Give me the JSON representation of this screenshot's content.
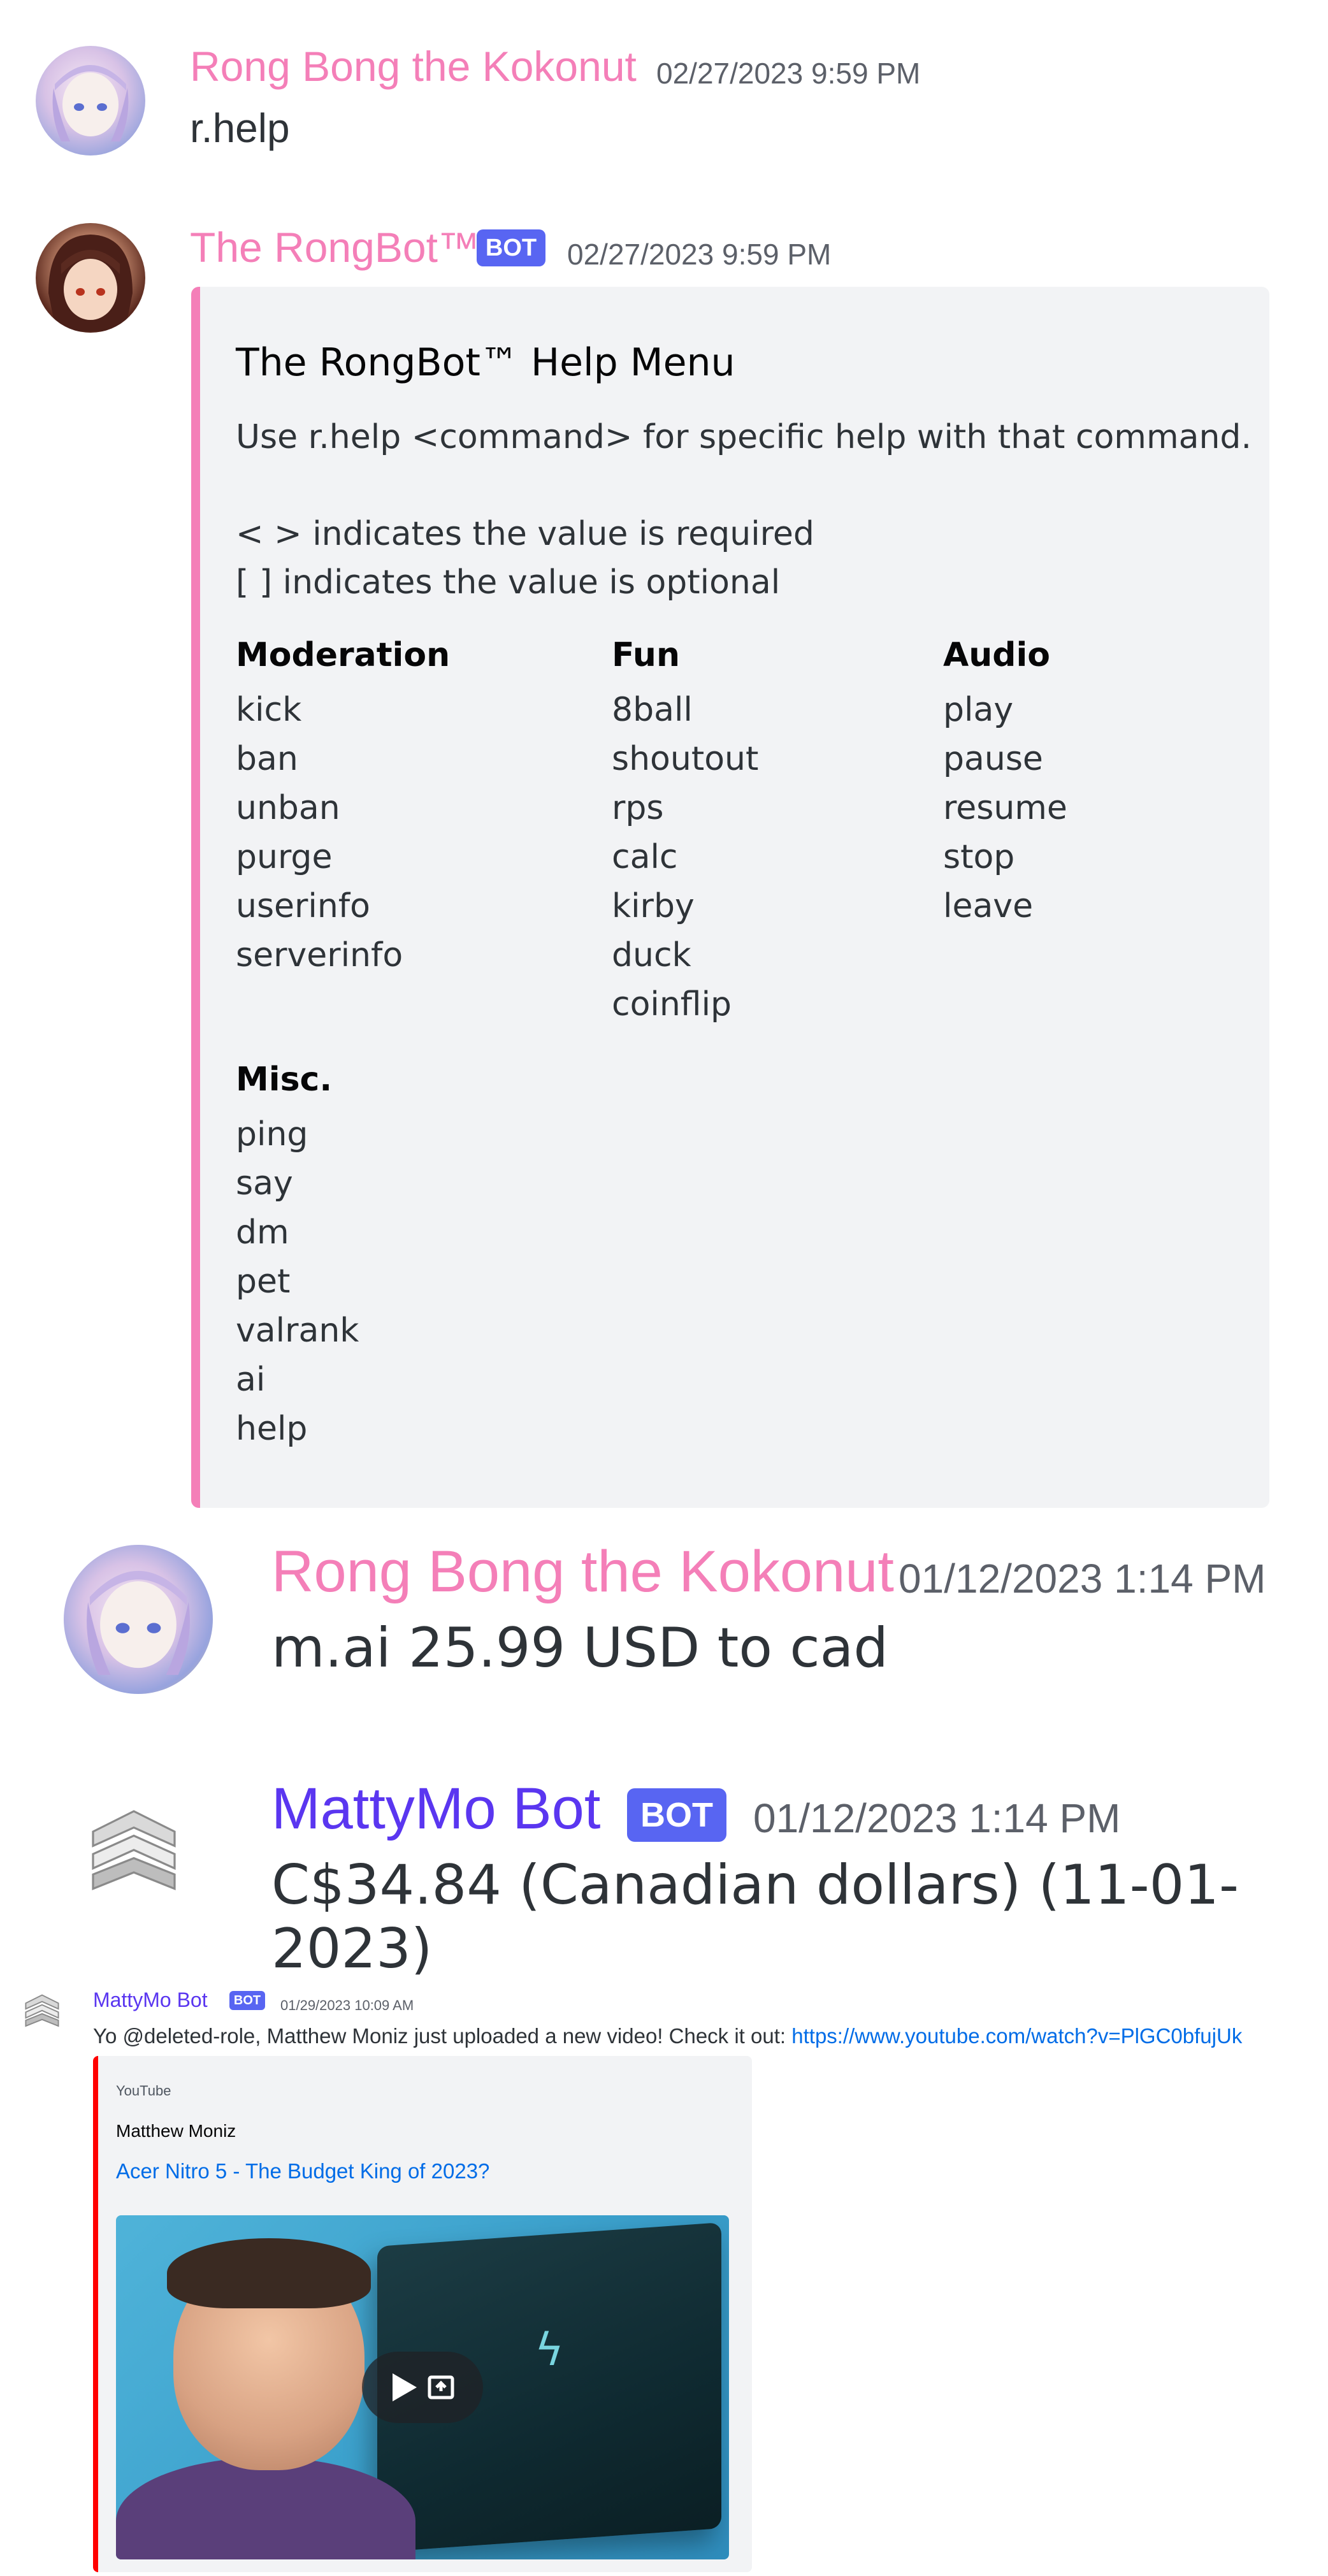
{
  "messages": [
    {
      "author": "Rong Bong the Kokonut",
      "timestamp": "02/27/2023 9:59 PM",
      "content": "r.help"
    },
    {
      "author": "The RongBot™",
      "bot_tag": "BOT",
      "timestamp": "02/27/2023 9:59 PM",
      "embed": {
        "title": "The RongBot™ Help Menu",
        "description_line1": "Use r.help <command> for specific help with that command.",
        "description_line2": "< > indicates the value is required",
        "description_line3": "[ ] indicates the value is optional",
        "fields": {
          "moderation": {
            "title": "Moderation",
            "items": [
              "kick",
              "ban",
              "unban",
              "purge",
              "userinfo",
              "serverinfo"
            ]
          },
          "fun": {
            "title": "Fun",
            "items": [
              "8ball",
              "shoutout",
              "rps",
              "calc",
              "kirby",
              "duck",
              "coinflip"
            ]
          },
          "audio": {
            "title": "Audio",
            "items": [
              "play",
              "pause",
              "resume",
              "stop",
              "leave"
            ]
          },
          "misc": {
            "title": "Misc.",
            "items": [
              "ping",
              "say",
              "dm",
              "pet",
              "valrank",
              "ai",
              "help"
            ]
          }
        },
        "accent_color": "#f47fb8"
      }
    },
    {
      "author": "Rong Bong the Kokonut",
      "timestamp": "01/12/2023 1:14 PM",
      "content": "m.ai 25.99 USD to cad"
    },
    {
      "author": "MattyMo Bot",
      "bot_tag": "BOT",
      "timestamp": "01/12/2023 1:14 PM",
      "content": "C$34.84 (Canadian dollars) (11-01-2023)"
    },
    {
      "author": "MattyMo Bot",
      "bot_tag": "BOT",
      "timestamp": "01/29/2023 10:09 AM",
      "content_prefix": "Yo @deleted-role, Matthew Moniz just uploaded a new video! Check it out: ",
      "link": "https://www.youtube.com/watch?v=PlGC0bfujUk",
      "embed": {
        "provider": "YouTube",
        "author": "Matthew Moniz",
        "title": "Acer Nitro 5 - The Budget King of 2023?",
        "accent_color": "#ff0000"
      }
    }
  ],
  "colors": {
    "rong_name": "#f47fb8",
    "mattymo_name": "#5a36f0",
    "bot_tag_bg": "#5865f2",
    "link": "#006ce7",
    "embed_bg": "#f2f3f5"
  },
  "icons": {
    "avatar_mattymo": "stacked-chevron-logo-icon",
    "play": "play-icon",
    "popout": "popout-icon"
  }
}
